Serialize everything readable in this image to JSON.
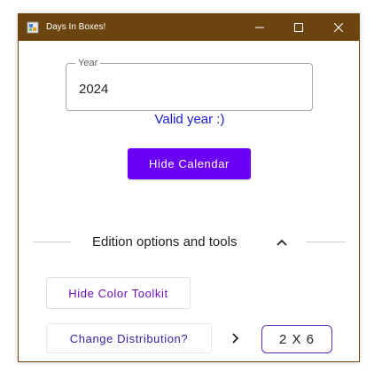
{
  "window": {
    "title": "Days In Boxes!",
    "controls": {
      "minimize_icon": "minimize-icon",
      "maximize_icon": "maximize-icon",
      "close_icon": "close-icon"
    },
    "titlebar_color": "#6b4410"
  },
  "year_field": {
    "label": "Year",
    "value": "2024"
  },
  "validation": {
    "message": "Valid year :)",
    "color": "#1a1ac8"
  },
  "calendar_toggle": {
    "label": "Hide Calendar",
    "color": "#6a00f4"
  },
  "edition_section": {
    "title": "Edition options and tools",
    "toggle_icon": "chevron-up-icon"
  },
  "tools": {
    "color_toolkit_label": "Hide Color Toolkit",
    "distribution_label": "Change Distribution?",
    "distribution_arrow_icon": "chevron-right-icon",
    "distribution_value": "2 X 6"
  }
}
